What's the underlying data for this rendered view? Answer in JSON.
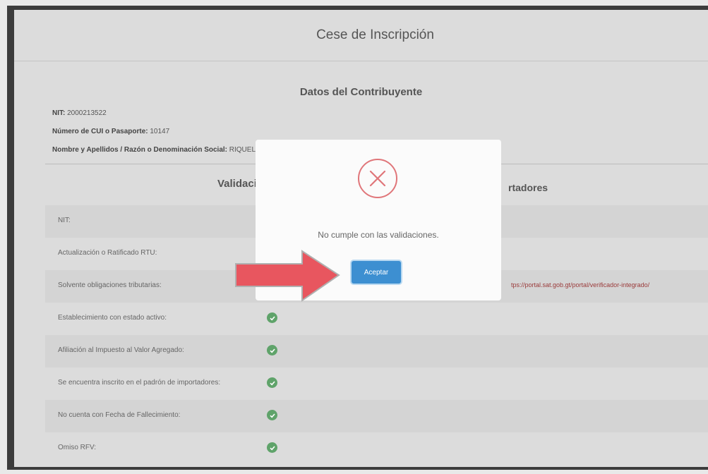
{
  "page": {
    "title": "Cese de Inscripción",
    "section_title": "Datos del Contribuyente"
  },
  "taxpayer": {
    "nit_label": "NIT:",
    "nit_value": "2000213522",
    "cui_label": "Número de CUI o Pasaporte:",
    "cui_value": "10147",
    "name_label": "Nombre y Apellidos / Razón o Denominación Social:",
    "name_value": "RIQUELME AN"
  },
  "validations": {
    "title": "Validació",
    "title_right": "rtadores",
    "rows": [
      {
        "label": "NIT:"
      },
      {
        "label": "Actualización o Ratificado RTU:"
      },
      {
        "label": "Solvente obligaciones tributarias:",
        "link": "tps://portal.sat.gob.gt/portal/verificador-integrado/"
      },
      {
        "label": "Establecimiento con estado activo:"
      },
      {
        "label": "Afiliación al Impuesto al Valor Agregado:"
      },
      {
        "label": "Se encuentra inscrito en el padrón de importadores:"
      },
      {
        "label": "No cuenta con Fecha de Fallecimiento:"
      },
      {
        "label": "Omiso RFV:"
      }
    ]
  },
  "modal": {
    "message": "No cumple con las validaciones.",
    "accept_label": "Aceptar"
  },
  "colors": {
    "error": "#e0767a",
    "button": "#3d8fd1",
    "check": "#5fa36a",
    "arrow": "#e8565f"
  },
  "icons": [
    "error-x-icon",
    "check-icon",
    "arrow-icon"
  ]
}
